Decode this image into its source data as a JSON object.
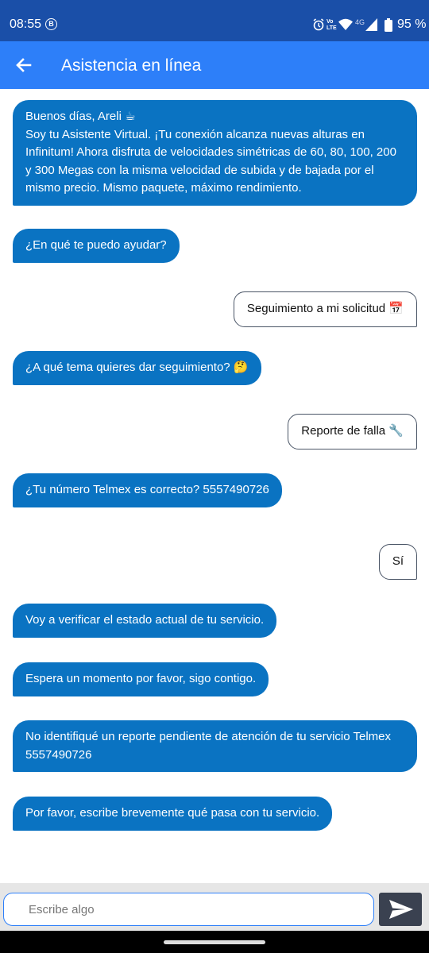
{
  "status_bar": {
    "time": "08:55",
    "app_badge": "B",
    "lte_label": "Vo LTE",
    "network_label": "4G",
    "battery": "95 %",
    "icons": [
      "alarm-icon",
      "volte-icon",
      "wifi-icon",
      "cell-signal-icon",
      "battery-icon"
    ]
  },
  "header": {
    "back_icon": "arrow-left-icon",
    "title": "Asistencia en línea"
  },
  "messages": [
    {
      "from": "bot",
      "text": "Buenos días, Areli ☕\nSoy tu Asistente Virtual. ¡Tu conexión alcanza nuevas alturas en Infinitum! Ahora disfruta de velocidades simétricas de 60, 80, 100, 200 y 300 Megas con la misma velocidad de subida y de bajada por el mismo precio. Mismo paquete, máximo rendimiento."
    },
    {
      "from": "bot",
      "text": "¿En qué te puedo ayudar?"
    },
    {
      "from": "user",
      "text": "Seguimiento a mi solicitud 📅"
    },
    {
      "from": "bot",
      "text": "¿A qué tema quieres dar seguimiento? 🤔"
    },
    {
      "from": "user",
      "text": "Reporte de falla 🔧"
    },
    {
      "from": "bot",
      "text": "¿Tu número Telmex es correcto? 5557490726"
    },
    {
      "from": "user",
      "text": "Sí"
    },
    {
      "from": "bot",
      "text": "Voy a verificar el estado actual de tu servicio."
    },
    {
      "from": "bot",
      "text": "Espera un momento por favor, sigo contigo."
    },
    {
      "from": "bot",
      "text": "No identifiqué un reporte pendiente de atención de tu servicio Telmex 5557490726"
    },
    {
      "from": "bot",
      "text": "Por favor, escribe brevemente qué pasa con tu servicio."
    }
  ],
  "composer": {
    "placeholder": "Escribe algo",
    "value": "",
    "send_icon": "send-icon"
  },
  "colors": {
    "status_bar": "#1a4fa8",
    "app_bar": "#2d7ff9",
    "bot_bubble": "#0a73c2",
    "send_button": "#3a4150"
  }
}
